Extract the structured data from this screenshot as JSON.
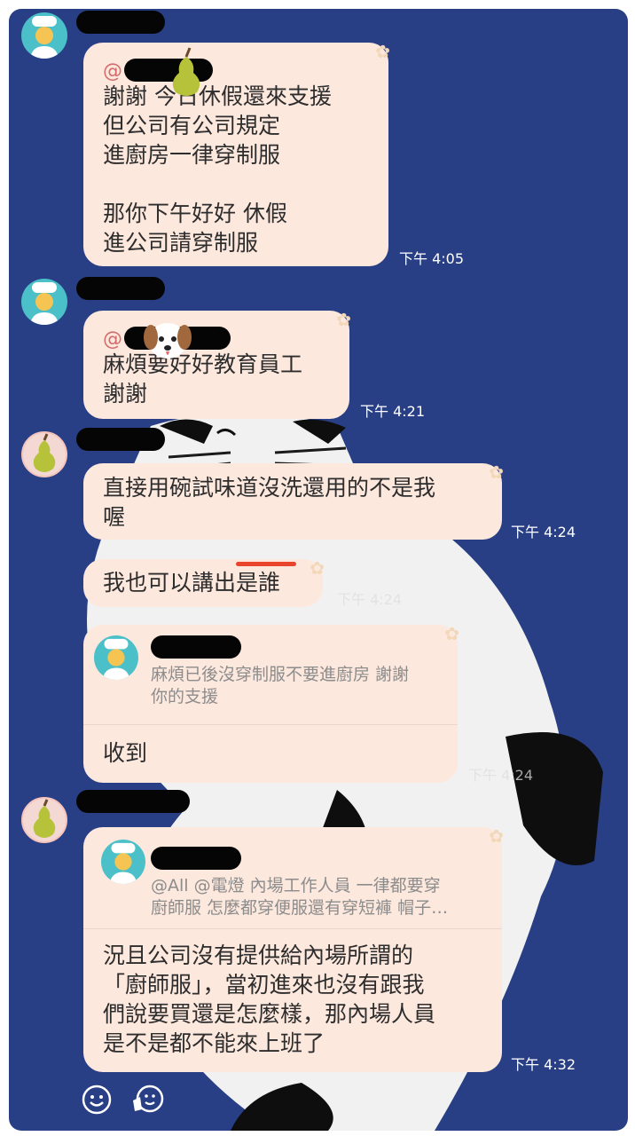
{
  "messages": [
    {
      "mention": "@",
      "text": "謝謝 今日休假還來支援\n但公司有公司規定\n進廚房一律穿制服\n\n那你下午好好 休假\n進公司請穿制服",
      "time": "下午 4:05"
    },
    {
      "mention": "@",
      "text": "麻煩要好好教育員工\n謝謝",
      "time": "下午 4:21"
    },
    {
      "text": "直接用碗試味道沒洗還用的不是我\n喔",
      "time": "下午 4:24"
    },
    {
      "text": "我也可以講出是誰",
      "time": "下午 4:24"
    },
    {
      "reply_text": "麻煩已後沒穿制服不要進廚房 謝謝\n你的支援",
      "text": "收到",
      "time": "下午 4:24"
    },
    {
      "reply_text": "@All @電燈 內場工作人員 一律都要穿\n廚師服 怎麼都穿便服還有穿短褲 帽子…",
      "text": "況且公司沒有提供給內場所謂的\n「廚師服」，當初進來也沒有跟我\n們說要買還是怎麼樣，那內場人員\n是不是都不能來上班了",
      "time": "下午 4:32"
    }
  ],
  "colors": {
    "background": "#283f86",
    "bubble": "#fde8de",
    "mention": "#d46a6a",
    "time": "#ffffff",
    "redaction": "#050505",
    "underline": "#e8452c"
  },
  "icons": {
    "chef_avatar": "chef-icon",
    "pear_avatar": "pear-icon",
    "dog_sticker": "dog-icon",
    "emoji_button": "smiley-icon",
    "sticker_button": "sticker-icon"
  }
}
